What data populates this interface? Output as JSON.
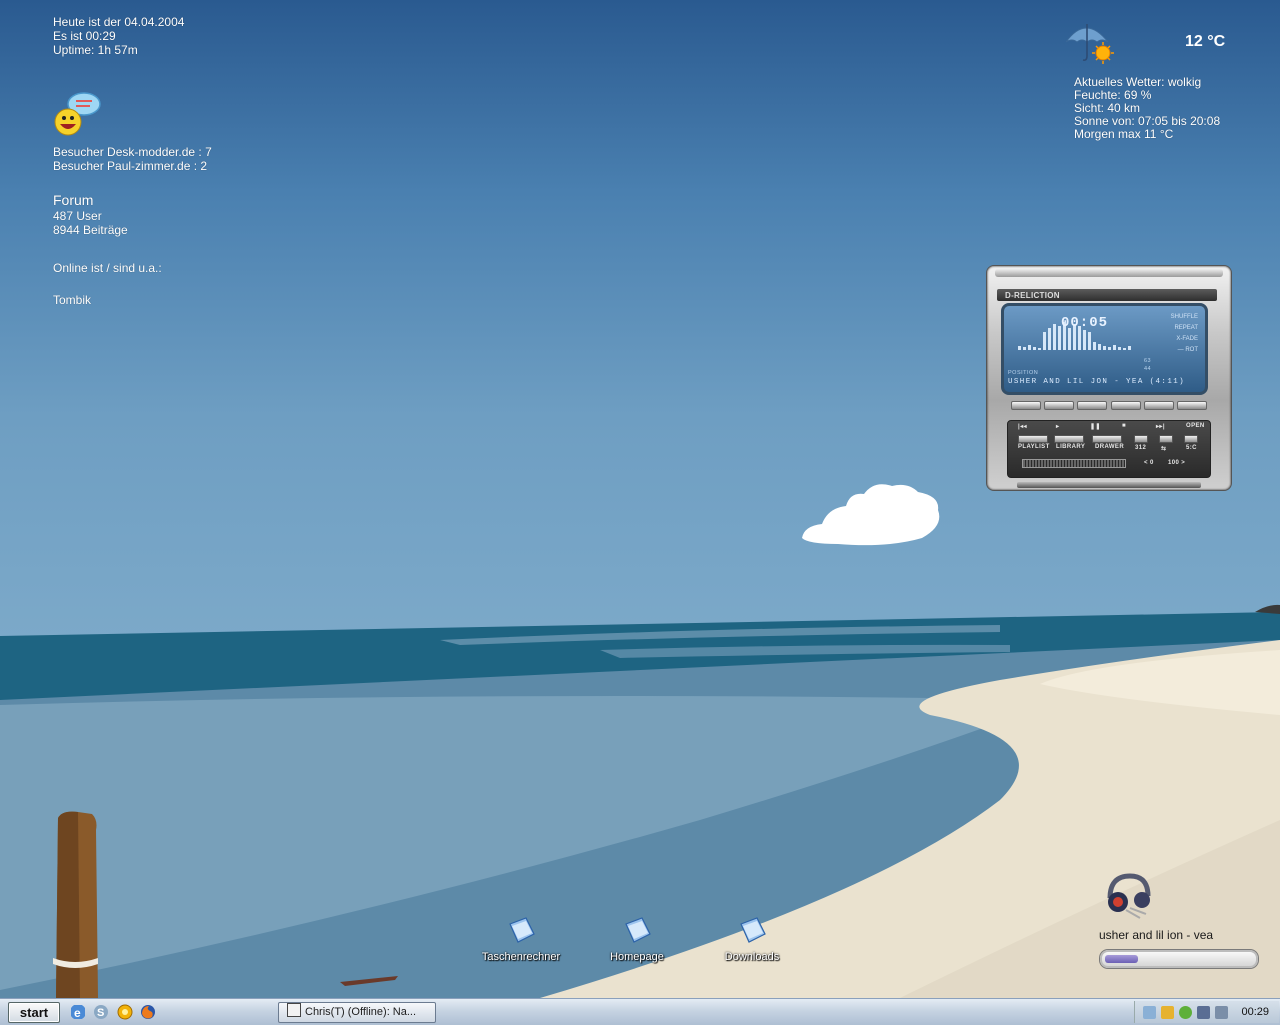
{
  "info": {
    "date_line": "Heute ist der 04.04.2004",
    "time_line": "Es ist 00:29",
    "uptime_line": "Uptime:  1h 57m"
  },
  "visitors": {
    "line1": "Besucher Desk-modder.de :  7",
    "line2": "Besucher Paul-zimmer.de :  2"
  },
  "forum": {
    "title": "Forum",
    "users": "487 User",
    "posts": "8944 Beiträge"
  },
  "online": {
    "heading": "Online ist / sind u.a.:",
    "user": "Tombik"
  },
  "weather": {
    "icon": "umbrella-sun-icon",
    "temperature": "12 °C",
    "condition": "Aktuelles Wetter: wolkig",
    "humidity": "Feuchte: 69 %",
    "visibility": "Sicht: 40 km",
    "sun": "Sonne von: 07:05  bis 20:08",
    "tomorrow": "Morgen max 11  °C"
  },
  "player": {
    "skin_title": "D-RELICTION",
    "time": "00:05",
    "track": "USHER AND LIL JON - YEA (4:11)",
    "options": [
      "SHUFFLE",
      "REPEAT",
      "X-FADE",
      "— ROT"
    ],
    "position_label": "POSITION",
    "kbps": "63",
    "khz": "44",
    "panel_buttons": [
      "PLAYLIST",
      "LIBRARY",
      "DRAWER"
    ],
    "small_buttons": [
      "312",
      "⇆",
      "5:C"
    ],
    "volume_labels": [
      "< 0",
      "100 >"
    ],
    "transport": [
      "|◂◂",
      "▸",
      "❚❚",
      "■",
      "▸▸|",
      "OPEN"
    ]
  },
  "desktop_icons": [
    {
      "label": "Taschenrechner",
      "icon": "document-icon"
    },
    {
      "label": "Homepage",
      "icon": "document-icon"
    },
    {
      "label": "Downloads",
      "icon": "document-icon"
    }
  ],
  "now_playing": {
    "icon": "headphones-icon",
    "label": "usher and lil ion - vea",
    "progress": 0.22
  },
  "taskbar": {
    "start_label": "start",
    "task_label": "Chris(T) (Offline): Na...",
    "clock": "00:29",
    "quick_launch": [
      "ie-icon",
      "messenger-icon",
      "winamp-icon",
      "firefox-icon"
    ],
    "tray_icons": [
      "network-icon",
      "pencil-icon",
      "green-status-icon",
      "monitor-icon",
      "speaker-icon"
    ]
  },
  "colors": {
    "sky_top": "#2a5a90",
    "sea": "#1e6482",
    "sand": "#eae2cf",
    "taskbar": "#c6d3e2"
  }
}
